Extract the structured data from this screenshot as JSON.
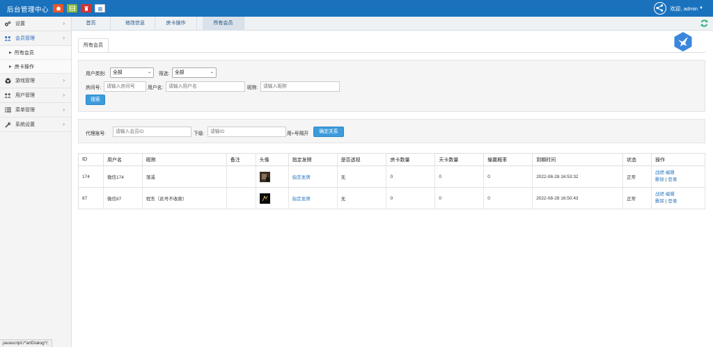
{
  "header": {
    "brand": "后台管理中心",
    "welcome": "欢迎, admin",
    "toolbar_icons": [
      {
        "name": "home-icon",
        "color": "#e8562a"
      },
      {
        "name": "grid-icon",
        "color": "#86b53d"
      },
      {
        "name": "trash-icon",
        "color": "#d53232"
      },
      {
        "name": "list-icon",
        "color": "#ffffff"
      }
    ]
  },
  "sidebar": {
    "items": [
      {
        "label": "设置",
        "icon": "gears-icon"
      },
      {
        "label": "会员管理",
        "icon": "users-icon"
      },
      {
        "label": "游戏管理",
        "icon": "soccer-icon"
      },
      {
        "label": "用户管理",
        "icon": "users-icon"
      },
      {
        "label": "菜单管理",
        "icon": "list-icon"
      },
      {
        "label": "系统设置",
        "icon": "wrench-icon"
      }
    ],
    "subitems": [
      {
        "label": "所有会员"
      },
      {
        "label": "房卡操作"
      }
    ]
  },
  "tabs": [
    {
      "label": "首页"
    },
    {
      "label": "修改信息"
    },
    {
      "label": "房卡操作"
    },
    {
      "label": "所有会员"
    }
  ],
  "status_bar": "javascript:/*artDialog*/;",
  "page": {
    "subtab": "所有会员",
    "filter": {
      "user_type_label": "用户类别:",
      "user_type_value": "全部",
      "screen_label": "筛选:",
      "screen_value": "全部",
      "room_label": "房间号:",
      "room_placeholder": "请输入房间号",
      "username_label": "用户名:",
      "username_placeholder": "请输入用户名",
      "nickname_label": "昵称:",
      "nickname_placeholder": "请输入昵称",
      "search_button": "搜索"
    },
    "agent": {
      "agent_label": "代理账号:",
      "agent_placeholder": "请输入会员ID",
      "sub_label": "下级:",
      "sub_placeholder": "请输ID",
      "separator_hint": "用+号隔开",
      "confirm_button": "确定关系"
    }
  },
  "table": {
    "columns": [
      "ID",
      "用户名",
      "昵称",
      "备注",
      "头像",
      "指定发牌",
      "是否透视",
      "房卡数量",
      "天卡数量",
      "输赢概率",
      "到期时间",
      "状态",
      "操作"
    ],
    "rows": [
      {
        "id": "174",
        "username": "微信174",
        "nickname": "落溪",
        "remark": "",
        "deal": "指定发牌",
        "see_through": "无",
        "room_cards": "0",
        "day_cards": "0",
        "win_rate": "0",
        "expire": "2022-08-28 16:53:32",
        "status": "正常",
        "op_record": "战绩",
        "op_edit": "编辑",
        "op_delete": "删除",
        "op_sep": "|",
        "op_login": "登录"
      },
      {
        "id": "87",
        "username": "微信87",
        "nickname": "程东（此号不收款）",
        "remark": "",
        "deal": "指定发牌",
        "see_through": "无",
        "room_cards": "0",
        "day_cards": "0",
        "win_rate": "0",
        "expire": "2022-08-28 16:50:43",
        "status": "正常",
        "op_record": "战绩",
        "op_edit": "编辑",
        "op_delete": "删除",
        "op_sep": "|",
        "op_login": "登录"
      }
    ]
  }
}
